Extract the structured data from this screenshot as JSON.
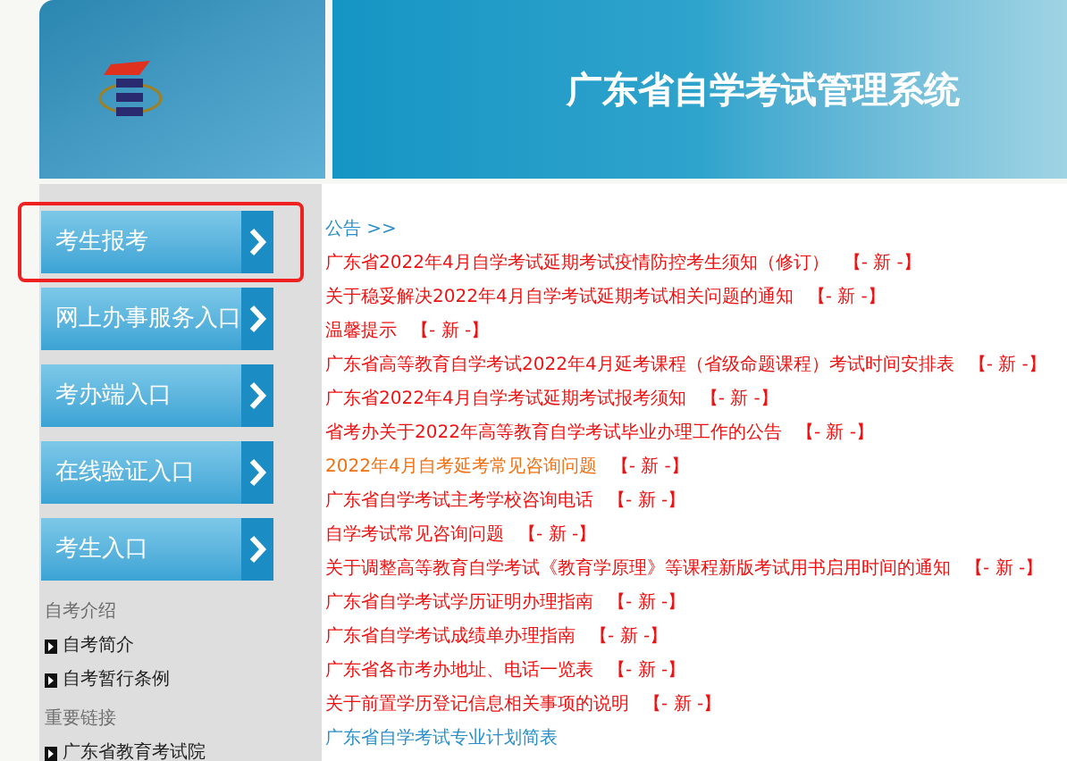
{
  "header": {
    "title": "广东省自学考试管理系统"
  },
  "nav_buttons": [
    {
      "label": "考生报考",
      "highlighted": true
    },
    {
      "label": "网上办事服务入口",
      "highlighted": false
    },
    {
      "label": "考办端入口",
      "highlighted": false
    },
    {
      "label": "在线验证入口",
      "highlighted": false
    },
    {
      "label": "考生入口",
      "highlighted": false
    }
  ],
  "sidebar_sections": [
    {
      "heading": "自考介绍",
      "links": [
        "自考简介",
        "自考暂行条例"
      ]
    },
    {
      "heading": "重要链接",
      "links": [
        "广东省教育考试院"
      ]
    }
  ],
  "notices": {
    "heading": "公告 >>",
    "items": [
      {
        "title": "广东省2022年4月自学考试延期考试疫情防控考生须知（修订）",
        "color": "#ee1111",
        "new_tag": "【- 新 -】"
      },
      {
        "title": "关于稳妥解决2022年4月自学考试延期考试相关问题的通知",
        "color": "#ee1111",
        "new_tag": "【- 新 -】"
      },
      {
        "title": "温馨提示",
        "color": "#ee1111",
        "new_tag": "【- 新 -】"
      },
      {
        "title": "广东省高等教育自学考试2022年4月延考课程（省级命题课程）考试时间安排表",
        "color": "#ee1111",
        "new_tag": "【- 新 -】"
      },
      {
        "title": "广东省2022年4月自学考试延期考试报考须知",
        "color": "#ee1111",
        "new_tag": "【- 新 -】"
      },
      {
        "title": "省考办关于2022年高等教育自学考试毕业办理工作的公告",
        "color": "#ee1111",
        "new_tag": "【- 新 -】"
      },
      {
        "title": "2022年4月自考延考常见咨询问题",
        "color": "#f07010",
        "new_tag": "【- 新 -】"
      },
      {
        "title": "广东省自学考试主考学校咨询电话",
        "color": "#ee1111",
        "new_tag": "【- 新 -】"
      },
      {
        "title": "自学考试常见咨询问题",
        "color": "#ee1111",
        "new_tag": "【- 新 -】"
      },
      {
        "title": "关于调整高等教育自学考试《教育学原理》等课程新版考试用书启用时间的通知",
        "color": "#ee1111",
        "new_tag": "【- 新 -】"
      },
      {
        "title": "广东省自学考试学历证明办理指南",
        "color": "#ee1111",
        "new_tag": "【- 新 -】"
      },
      {
        "title": "广东省自学考试成绩单办理指南",
        "color": "#ee1111",
        "new_tag": "【- 新 -】"
      },
      {
        "title": "广东省各市考办地址、电话一览表",
        "color": "#ee1111",
        "new_tag": "【- 新 -】"
      },
      {
        "title": "关于前置学历登记信息相关事项的说明",
        "color": "#ee1111",
        "new_tag": "【- 新 -】"
      },
      {
        "title": "广东省自学考试专业计划简表",
        "color": "#2a8fc8"
      }
    ]
  }
}
